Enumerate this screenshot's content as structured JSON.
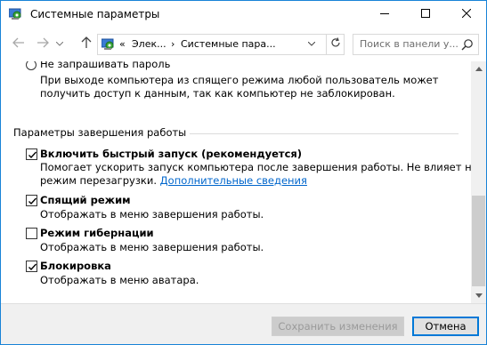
{
  "window": {
    "title": "Системные параметры",
    "accent_color": "#1883d7"
  },
  "navbar": {
    "breadcrumb_prefix": "«",
    "breadcrumb_1": "Элек...",
    "breadcrumb_sep": "›",
    "breadcrumb_2": "Системные пара...",
    "search_placeholder": "Поиск в панели у...",
    "icons": [
      "back-arrow",
      "forward-arrow",
      "recent-dropdown",
      "up-arrow",
      "control-panel",
      "refresh",
      "search"
    ]
  },
  "password_option": {
    "label": "Не запрашивать пароль",
    "desc_line1": "При выходе компьютера из спящего режима любой пользователь может",
    "desc_line2": "получить доступ к данным, так как компьютер не заблокирован."
  },
  "shutdown_section": {
    "title": "Параметры завершения работы",
    "items": [
      {
        "label": "Включить быстрый запуск (рекомендуется)",
        "checked": true,
        "desc_line1": "Помогает ускорить запуск компьютера после завершения работы. Не влияет на",
        "desc_line2": "режим перезагрузки.",
        "link": "Дополнительные сведения"
      },
      {
        "label": "Спящий режим",
        "checked": true,
        "desc_line1": "Отображать в меню завершения работы."
      },
      {
        "label": "Режим гибернации",
        "checked": false,
        "desc_line1": "Отображать в меню завершения работы."
      },
      {
        "label": "Блокировка",
        "checked": true,
        "desc_line1": "Отображать в меню аватара."
      }
    ]
  },
  "footer": {
    "save_label": "Сохранить изменения",
    "cancel_label": "Отмена"
  }
}
